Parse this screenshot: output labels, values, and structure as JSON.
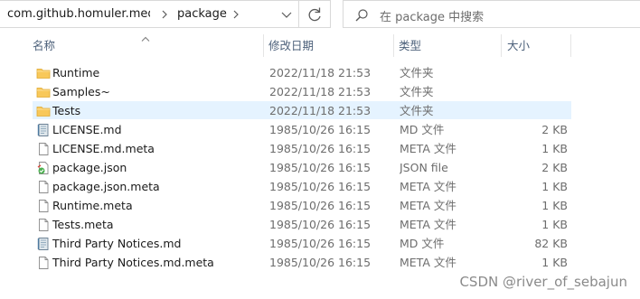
{
  "address": {
    "crumbs": [
      "com.github.homuler.media...",
      "package"
    ]
  },
  "search": {
    "placeholder": "在 package 中搜索"
  },
  "columns": {
    "name": "名称",
    "date": "修改日期",
    "type": "类型",
    "size": "大小"
  },
  "files": [
    {
      "name": "Runtime",
      "date": "2022/11/18 21:53",
      "type": "文件夹",
      "size": "",
      "icon": "folder-icon"
    },
    {
      "name": "Samples~",
      "date": "2022/11/18 21:53",
      "type": "文件夹",
      "size": "",
      "icon": "folder-icon"
    },
    {
      "name": "Tests",
      "date": "2022/11/18 21:53",
      "type": "文件夹",
      "size": "",
      "icon": "folder-icon",
      "selected": true
    },
    {
      "name": "LICENSE.md",
      "date": "1985/10/26 16:15",
      "type": "MD 文件",
      "size": "2 KB",
      "icon": "md-file-icon"
    },
    {
      "name": "LICENSE.md.meta",
      "date": "1985/10/26 16:15",
      "type": "META 文件",
      "size": "1 KB",
      "icon": "file-icon"
    },
    {
      "name": "package.json",
      "date": "1985/10/26 16:15",
      "type": "JSON file",
      "size": "2 KB",
      "icon": "json-file-icon"
    },
    {
      "name": "package.json.meta",
      "date": "1985/10/26 16:15",
      "type": "META 文件",
      "size": "1 KB",
      "icon": "file-icon"
    },
    {
      "name": "Runtime.meta",
      "date": "1985/10/26 16:15",
      "type": "META 文件",
      "size": "1 KB",
      "icon": "file-icon"
    },
    {
      "name": "Tests.meta",
      "date": "1985/10/26 16:15",
      "type": "META 文件",
      "size": "1 KB",
      "icon": "file-icon"
    },
    {
      "name": "Third Party Notices.md",
      "date": "1985/10/26 16:15",
      "type": "MD 文件",
      "size": "82 KB",
      "icon": "md-file-icon"
    },
    {
      "name": "Third Party Notices.md.meta",
      "date": "1985/10/26 16:15",
      "type": "META 文件",
      "size": "1 KB",
      "icon": "file-icon"
    }
  ],
  "watermark": "CSDN @river_of_sebajun",
  "colors": {
    "selection": "#e5f3ff",
    "folder": "#f8c85a",
    "header_text": "#4c607a",
    "muted_text": "#6d6d6d"
  }
}
